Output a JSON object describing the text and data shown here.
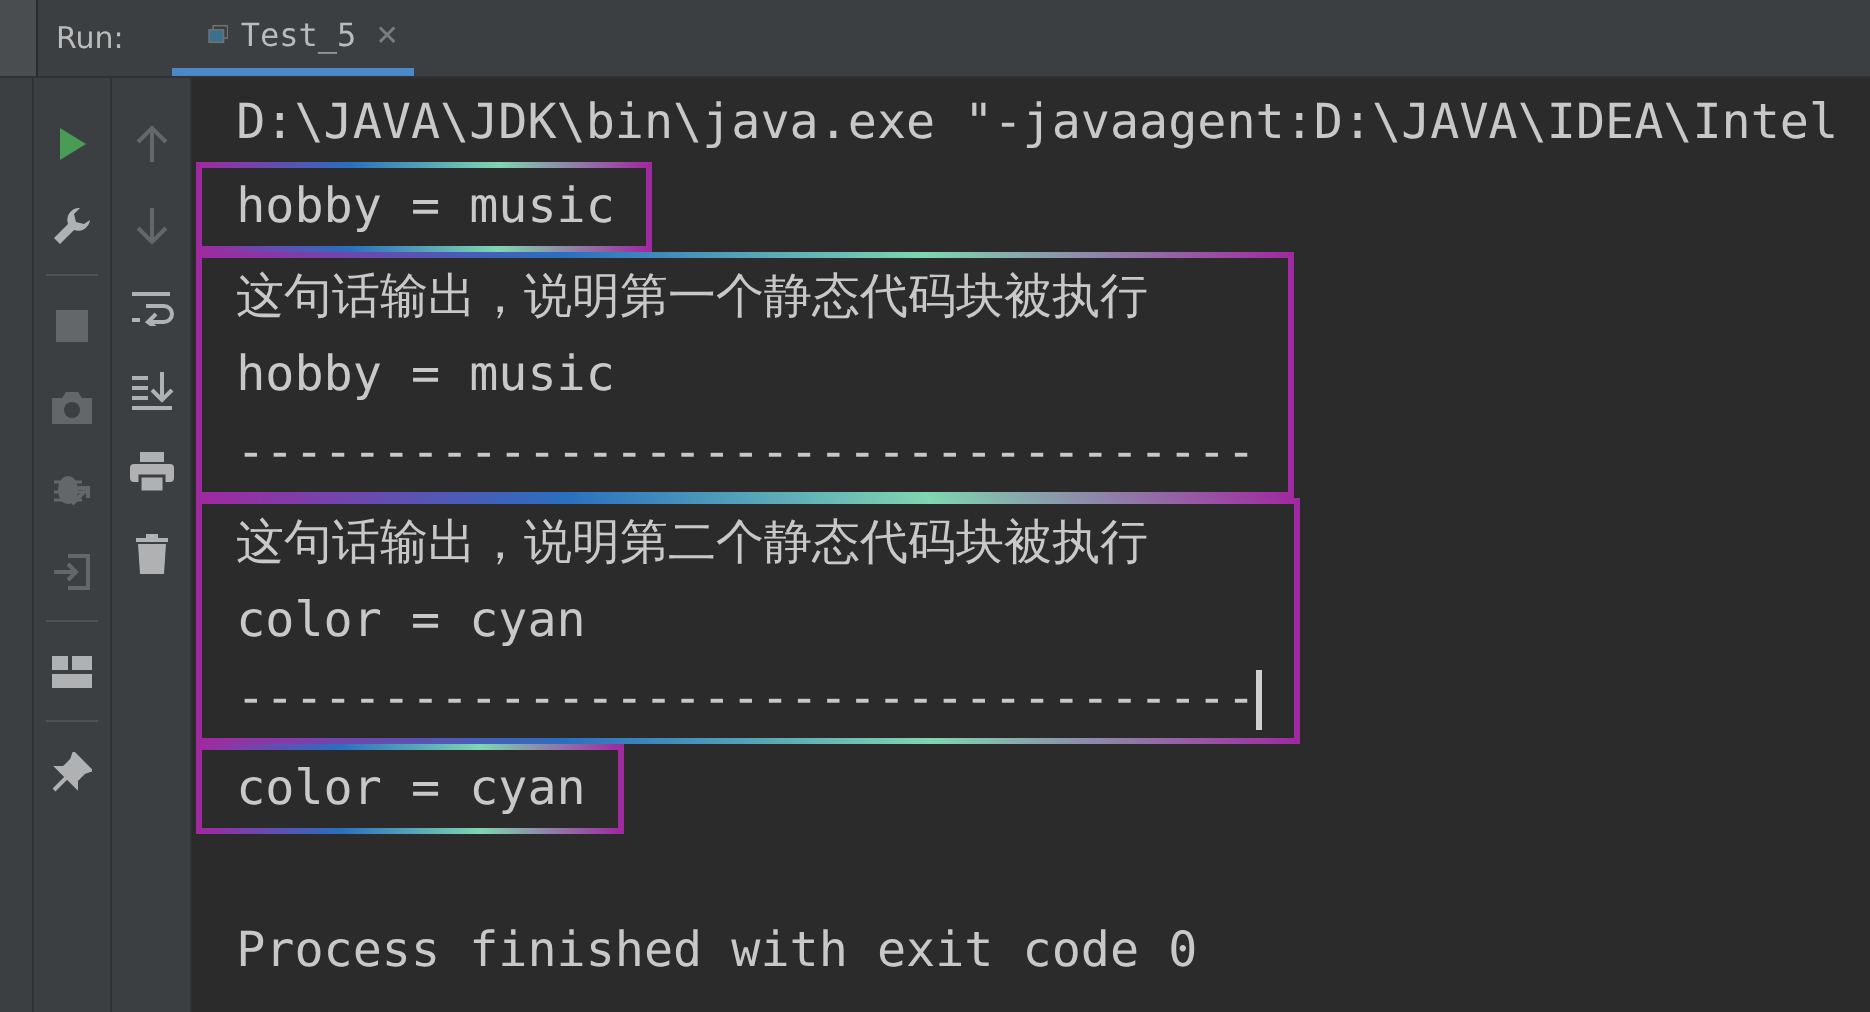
{
  "run_bar": {
    "label": "Run:",
    "tabs": [
      {
        "label": "Test_5",
        "close": "×",
        "selected": true
      }
    ]
  },
  "toolbar_left": [
    {
      "kind": "run",
      "disabled": false
    },
    {
      "kind": "wrench",
      "disabled": false
    },
    {
      "kind": "separator"
    },
    {
      "kind": "stop",
      "disabled": true
    },
    {
      "kind": "camera",
      "disabled": true
    },
    {
      "kind": "bug",
      "disabled": true
    },
    {
      "kind": "enter",
      "disabled": true
    },
    {
      "kind": "separator"
    },
    {
      "kind": "layout",
      "disabled": false
    },
    {
      "kind": "separator"
    },
    {
      "kind": "pin",
      "disabled": false
    }
  ],
  "toolbar_right": [
    {
      "kind": "up",
      "disabled": true
    },
    {
      "kind": "down",
      "disabled": true
    },
    {
      "kind": "wrap",
      "disabled": false
    },
    {
      "kind": "scroll-end",
      "disabled": false
    },
    {
      "kind": "print",
      "disabled": false
    },
    {
      "kind": "trash",
      "disabled": false
    }
  ],
  "console": {
    "blocks": [
      {
        "framed": false,
        "lines": [
          "D:\\JAVA\\JDK\\bin\\java.exe \"-javaagent:D:\\JAVA\\IDEA\\Intel"
        ]
      },
      {
        "framed": true,
        "lines": [
          "hobby = music"
        ]
      },
      {
        "framed": true,
        "lines": [
          "这句话输出，说明第一个静态代码块被执行",
          "hobby = music",
          "-----------------------------------"
        ]
      },
      {
        "framed": true,
        "caret": true,
        "lines": [
          "这句话输出，说明第二个静态代码块被执行",
          "color = cyan",
          "-----------------------------------"
        ]
      },
      {
        "framed": true,
        "lines": [
          "color = cyan"
        ]
      },
      {
        "framed": false,
        "gap_before": true,
        "lines": [
          "Process finished with exit code 0"
        ]
      }
    ]
  }
}
